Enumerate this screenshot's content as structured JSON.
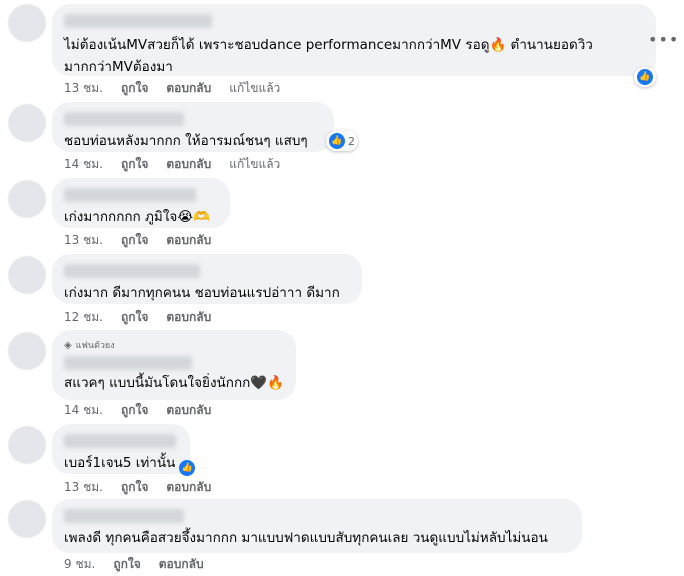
{
  "labels": {
    "like": "ถูกใจ",
    "reply": "ตอบกลับ",
    "edited": "แก้ไขแล้ว"
  },
  "icons": {
    "more": "more-dots-icon",
    "like": "thumbs-up-icon",
    "fire": "fire-emoji",
    "crying": "crying-emoji",
    "heart_black": "black-heart-emoji",
    "diamond": "diamond-icon"
  },
  "colors": {
    "accent": "#1877f2",
    "bubble": "#f0f2f5",
    "meta": "#65676b"
  },
  "comments": [
    {
      "text": "ไม่ต้องเน้นMVสวยก็ได้ เพราะชอบdance performanceมากกว่าMV รอดู🔥 ตำนานยอดวิวมากกว่าMVต้องมา",
      "time": "13 ชม.",
      "edited": true,
      "reactions": ""
    },
    {
      "text": "ชอบท่อนหลังมากกก ให้อารมณ์ชนๆ แสบๆ",
      "time": "14 ชม.",
      "edited": true,
      "reactions": "2"
    },
    {
      "text": "เก่งมากกกกก ภูมิใจ😭🫶",
      "time": "13 ชม.",
      "edited": false,
      "reactions": ""
    },
    {
      "text": "เก่งมาก ดีมากทุกคนน ชอบท่อนแรปอ่าาา ดีมาก",
      "time": "12 ชม.",
      "edited": false,
      "reactions": ""
    },
    {
      "badge": "แฟนตัวยง",
      "text": "สแวคๆ แบบนี้มันโดนใจยิ่งนักกก🖤🔥",
      "time": "14 ชม.",
      "edited": false,
      "reactions": ""
    },
    {
      "text": "เบอร์1เจน5 เท่านั้น",
      "time": "13 ชม.",
      "edited": false,
      "reactions": ""
    },
    {
      "text": "เพลงดี ทุกคนคือสวยจึ้งมากกก มาแบบฟาดแบบสับทุกคนเลย วนดูแบบไม่หลับไม่นอน",
      "time": "9 ชม.",
      "edited": false,
      "reactions": ""
    }
  ]
}
